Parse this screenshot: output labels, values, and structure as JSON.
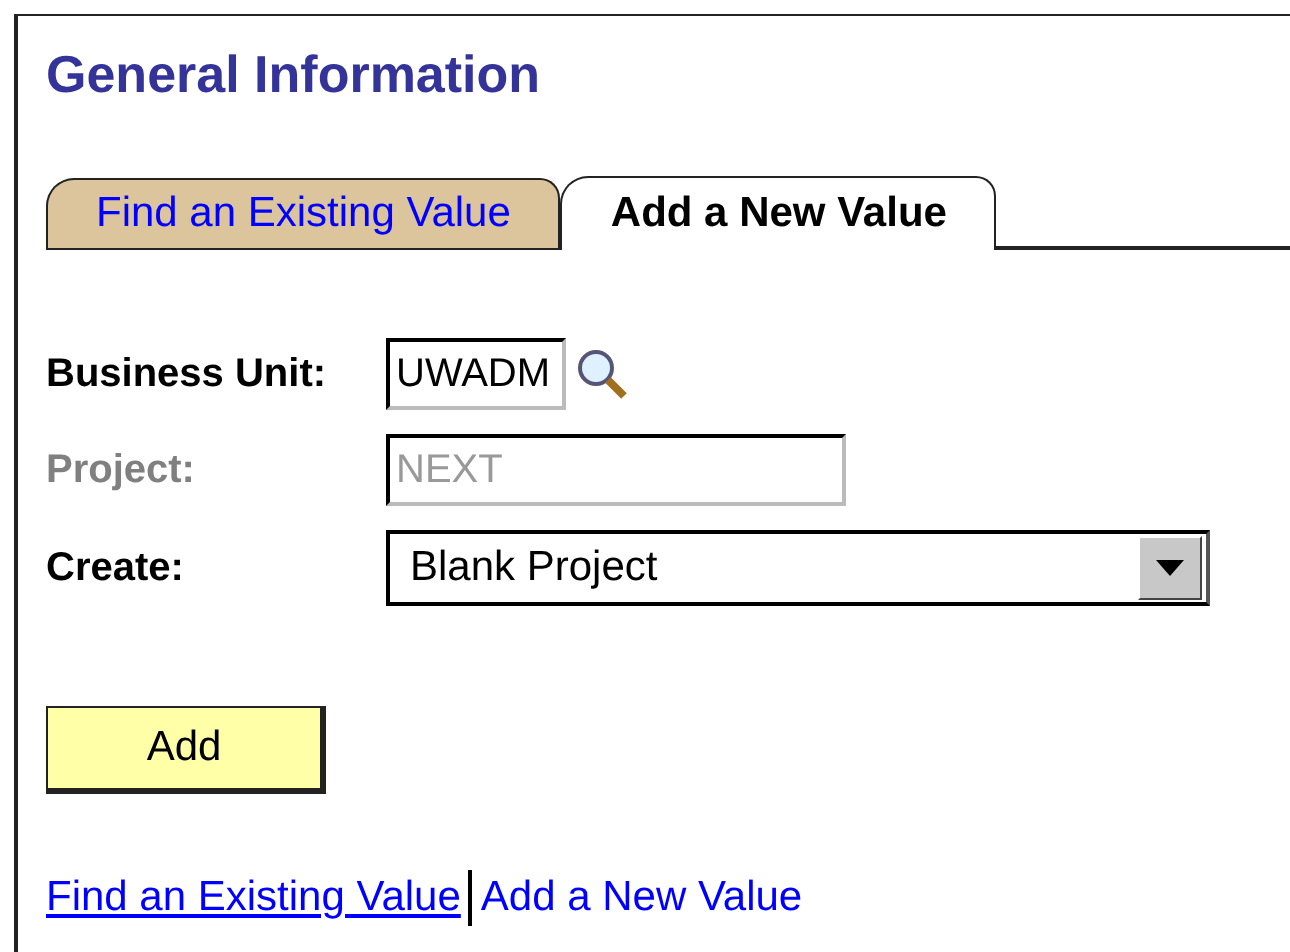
{
  "title": "General Information",
  "tabs": [
    {
      "label": "Find an Existing Value",
      "selected": false
    },
    {
      "label": "Add a New Value",
      "selected": true
    }
  ],
  "fields": [
    {
      "kind": "lookup",
      "label": "Business Unit:",
      "value": "UWADM",
      "disabled": false
    },
    {
      "kind": "text",
      "label": "Project:",
      "value": "NEXT",
      "disabled": true
    },
    {
      "kind": "select",
      "label": "Create:",
      "value": "Blank Project",
      "disabled": false
    }
  ],
  "add_button": "Add",
  "links": [
    {
      "label": "Find an Existing Value",
      "selected": false
    },
    {
      "label": "Add a New Value",
      "selected": true
    }
  ]
}
